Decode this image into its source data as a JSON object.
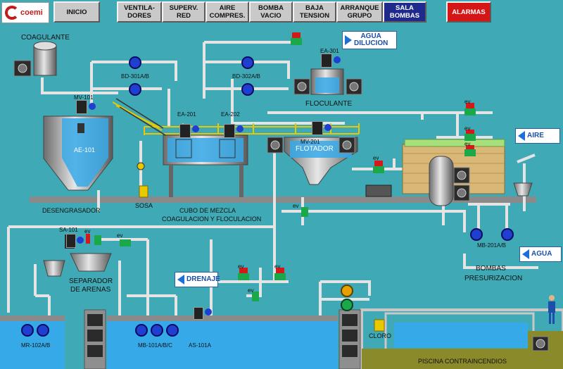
{
  "brand": {
    "logo_text": "coemi"
  },
  "nav": {
    "inicio": "INICIO",
    "ventiladores": "VENTILA-\nDORES",
    "superv_red": "SUPERV.\nRED",
    "aire_compres": "AIRE\nCOMPRES.",
    "bomba_vacio": "BOMBA\nVACIO",
    "baja_tension": "BAJA\nTENSION",
    "arranque_grupo": "ARRANQUE\nGRUPO",
    "sala_bombas": "SALA\nBOMBAS",
    "alarmas": "ALARMAS"
  },
  "process": {
    "coagulante": "COAGULANTE",
    "bd301": "BD-301A/B",
    "bd302": "BD-302A/B",
    "mv101": "MV-101",
    "ae101": "AE-101",
    "ea201": "EA-201",
    "ea202": "EA-202",
    "ea301": "EA-301",
    "floculante": "FLOCULANTE",
    "mv201": "MV-201",
    "flotador": "FLOTADOR",
    "desengrasador": "DESENGRASADOR",
    "sosa": "SOSA",
    "cubo_mezcla": "CUBO DE MEZCLA",
    "coag_floc": "COAGULACION Y FLOCULACION",
    "sa101": "SA-101",
    "separador_1": "SEPARADOR",
    "separador_2": "DE ARENAS",
    "mr102": "MR-102A/B",
    "mb101": "MB-101A/B/C",
    "as101": "AS-101A",
    "mb201": "MB-201A/B",
    "bombas_1": "BOMBAS",
    "bombas_2": "PRESURIZACION",
    "cloro": "CLORO",
    "piscina": "PISCINA CONTRAINCENDIOS",
    "ev": "ev"
  },
  "actions": {
    "agua_dilucion_1": "AGUA",
    "agua_dilucion_2": "DILUCION",
    "aire": "AIRE",
    "agua": "AGUA",
    "drenaje": "DRENAJE"
  },
  "colors": {
    "background": "#3fa9b5",
    "pipe": "#e8e8e8",
    "water": "#36a9e8",
    "pump": "#1f3fd0",
    "valve_open": "#1aa84a",
    "valve_closed": "#d11b1b"
  }
}
